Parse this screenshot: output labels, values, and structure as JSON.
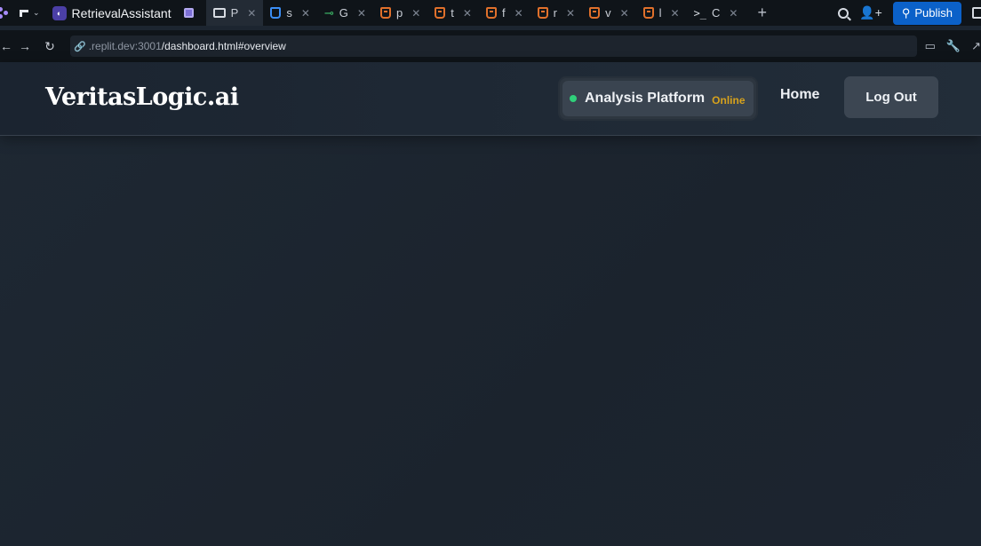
{
  "browser": {
    "project_name": "RetrievalAssistant",
    "tabs": [
      {
        "label": "P",
        "icon": "monitor-icon",
        "active": true
      },
      {
        "label": "s",
        "icon": "css-file-icon"
      },
      {
        "label": "G",
        "icon": "git-branch-icon"
      },
      {
        "label": "p",
        "icon": "html-file-icon"
      },
      {
        "label": "t",
        "icon": "html-file-icon"
      },
      {
        "label": "f",
        "icon": "html-file-icon"
      },
      {
        "label": "r",
        "icon": "html-file-icon"
      },
      {
        "label": "v",
        "icon": "html-file-icon"
      },
      {
        "label": "l",
        "icon": "html-file-icon"
      },
      {
        "label": "C",
        "icon": "terminal-icon"
      }
    ],
    "publish_label": "Publish",
    "url_host": ".replit.dev:3001",
    "url_path": "/dashboard.html#overview"
  },
  "app": {
    "brand": "VeritasLogic.ai",
    "status": {
      "label": "Analysis Platform",
      "state": "Online",
      "dot_color": "#2fd07a",
      "state_color": "#d7a21c"
    },
    "nav": {
      "home": "Home",
      "logout": "Log Out"
    }
  }
}
